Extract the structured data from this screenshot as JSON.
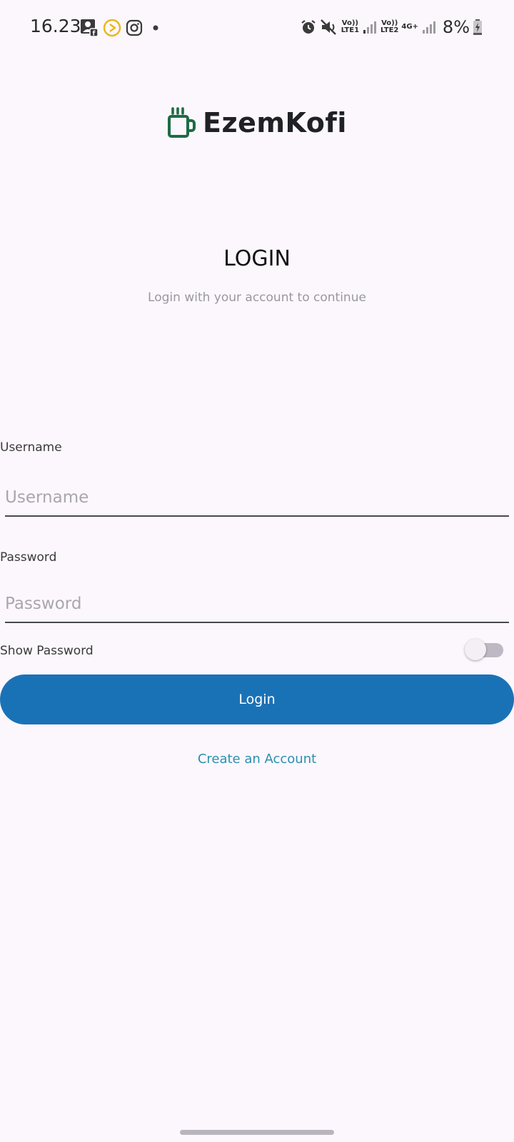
{
  "status_bar": {
    "time": "16.23",
    "battery": "8%",
    "sim1_label_top": "Vo))",
    "sim1_label_bottom": "LTE1",
    "sim2_label_top": "Vo))",
    "sim2_label_bottom": "LTE2",
    "network_type": "4G+",
    "icons_left": [
      "contact-card-icon",
      "play-circle-icon",
      "instagram-icon",
      "dot-icon"
    ],
    "icons_right": [
      "alarm-icon",
      "mute-icon",
      "signal-icon",
      "battery-charging-icon"
    ]
  },
  "brand": {
    "name": "EzemKofi",
    "color": "#1e6b45"
  },
  "login": {
    "title": "LOGIN",
    "subtitle": "Login with your account to continue",
    "username_label": "Username",
    "username_placeholder": "Username",
    "username_value": "",
    "password_label": "Password",
    "password_placeholder": "Password",
    "password_value": "",
    "show_password_label": "Show Password",
    "show_password_on": false,
    "button_label": "Login",
    "button_color": "#1a72b6",
    "create_account_label": "Create an Account",
    "link_color": "#2b8fb0"
  }
}
